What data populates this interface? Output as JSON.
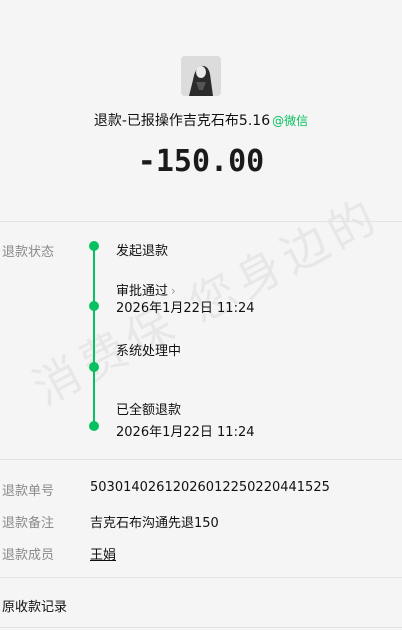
{
  "watermark": "消费保 您身边的",
  "header": {
    "merchant": "退款-已报操作吉克石布5.16",
    "source_tag": "@微信",
    "amount": "-150.00"
  },
  "refund_status": {
    "label": "退款状态",
    "steps": [
      {
        "title": "发起退款",
        "time": ""
      },
      {
        "title": "审批通过",
        "time": "2026年1月22日 11:24"
      },
      {
        "title": "系统处理中",
        "time": ""
      },
      {
        "title": "已全额退款",
        "time": "2026年1月22日 11:24"
      }
    ]
  },
  "details": {
    "refund_no_label": "退款单号",
    "refund_no": "5030140261202601225022044152​5",
    "remark_label": "退款备注",
    "remark": "吉克石布沟通先退150",
    "member_label": "退款成员",
    "member": "王娟"
  },
  "footer": {
    "original_record": "原收款记录"
  }
}
